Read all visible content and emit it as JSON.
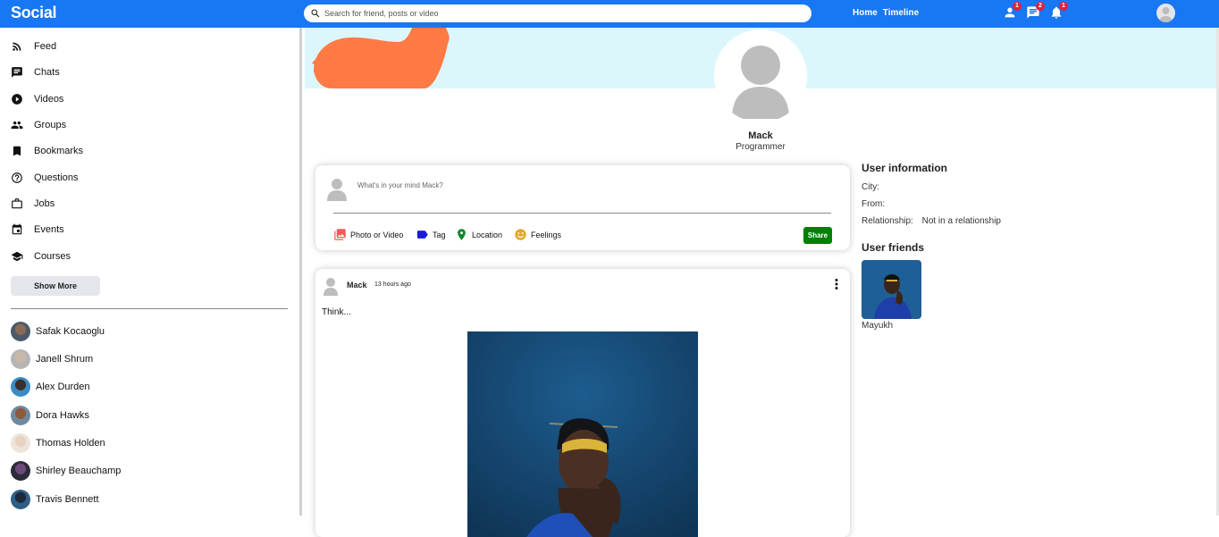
{
  "app": {
    "logo": "Social"
  },
  "search": {
    "placeholder": "Search for friend, posts or video"
  },
  "topnav": {
    "home": "Home",
    "timeline": "Timeline"
  },
  "notifications": {
    "friends": "1",
    "messages": "2",
    "alerts": "1"
  },
  "colors": {
    "brand": "#1877f2",
    "badge": "#e41e3f",
    "share": "#008000",
    "cover": "#dcf7fb"
  },
  "sidebar": {
    "items": [
      {
        "label": "Feed",
        "icon": "rss-icon"
      },
      {
        "label": "Chats",
        "icon": "chat-icon"
      },
      {
        "label": "Videos",
        "icon": "play-circle-icon"
      },
      {
        "label": "Groups",
        "icon": "group-icon"
      },
      {
        "label": "Bookmarks",
        "icon": "bookmark-icon"
      },
      {
        "label": "Questions",
        "icon": "help-circle-icon"
      },
      {
        "label": "Jobs",
        "icon": "briefcase-icon"
      },
      {
        "label": "Events",
        "icon": "calendar-icon"
      },
      {
        "label": "Courses",
        "icon": "school-icon"
      }
    ],
    "show_more": "Show More",
    "friends": [
      "Safak Kocaoglu",
      "Janell Shrum",
      "Alex Durden",
      "Dora Hawks",
      "Thomas Holden",
      "Shirley Beauchamp",
      "Travis Bennett"
    ]
  },
  "profile": {
    "name": "Mack",
    "description": "Programmer"
  },
  "share": {
    "placeholder": "What's in your mind Mack?",
    "options": [
      "Photo or Video",
      "Tag",
      "Location",
      "Feelings"
    ],
    "button": "Share"
  },
  "post": {
    "user": "Mack",
    "time": "13 hours ago",
    "text": "Think..."
  },
  "user_info": {
    "title": "User information",
    "city_label": "City:",
    "city": "",
    "from_label": "From:",
    "from": "",
    "relationship_label": "Relationship:",
    "relationship": "Not in a relationship"
  },
  "user_friends": {
    "title": "User friends",
    "friends": [
      {
        "name": "Mayukh"
      }
    ]
  }
}
